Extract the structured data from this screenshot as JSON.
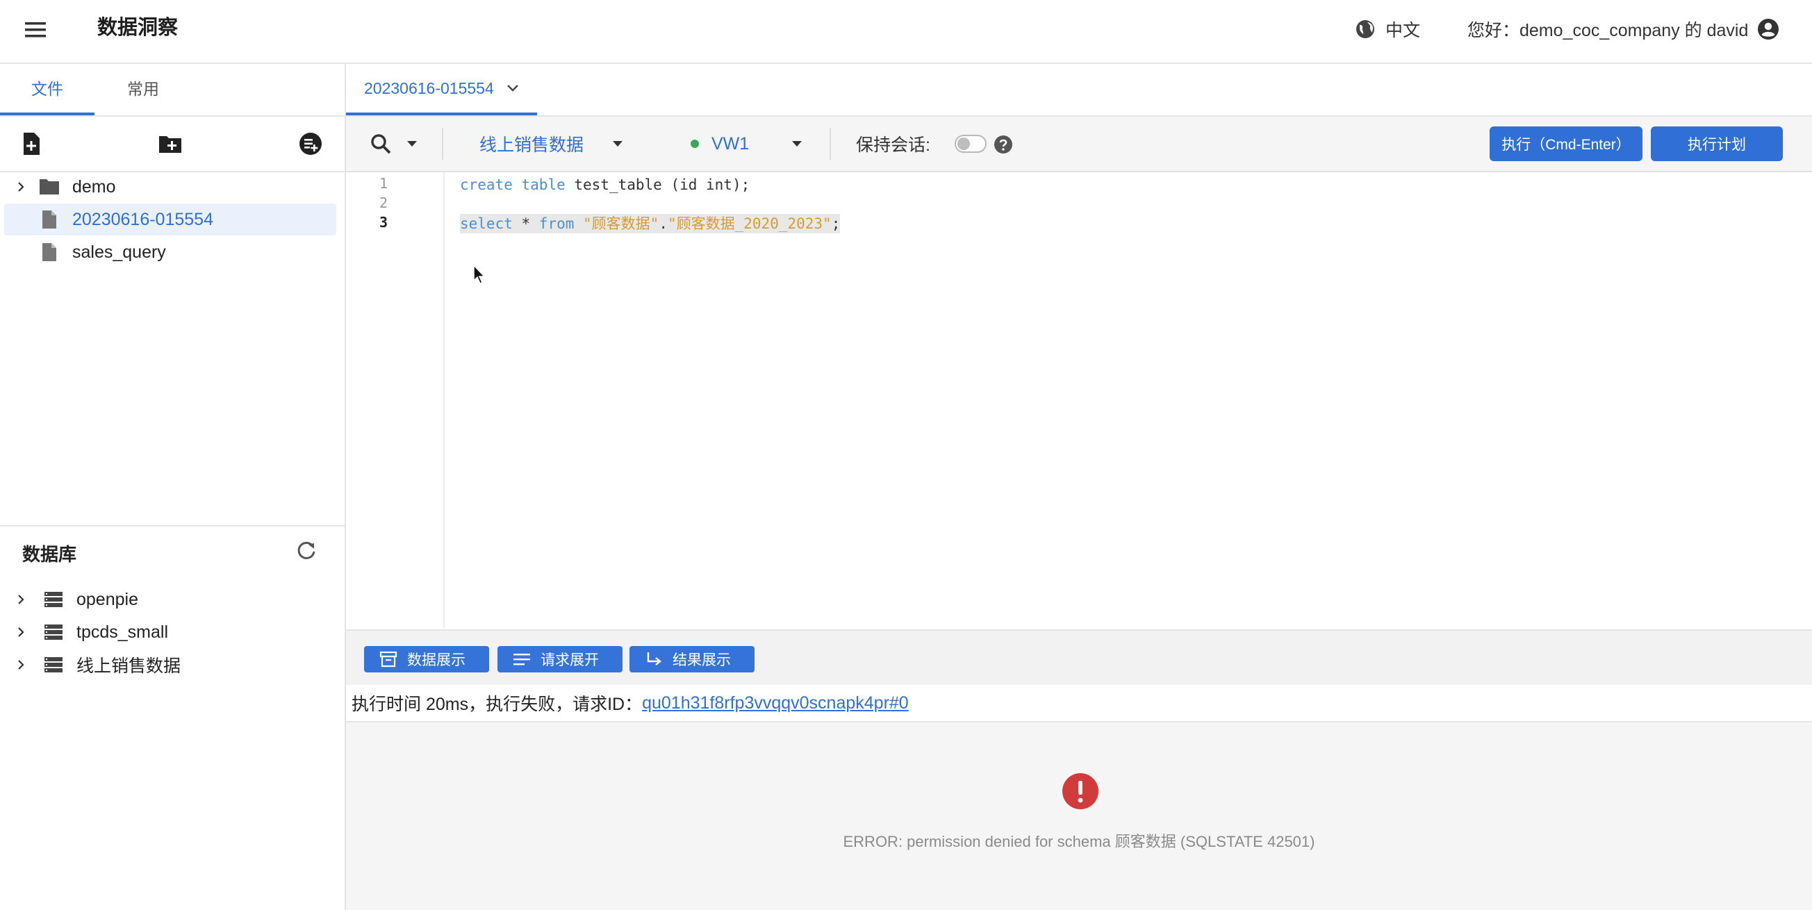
{
  "app": {
    "title": "数据洞察"
  },
  "header": {
    "language": "中文",
    "greeting": "您好：demo_coc_company 的 david"
  },
  "sidebar": {
    "tabs": [
      {
        "label": "文件",
        "active": true
      },
      {
        "label": "常用",
        "active": false
      }
    ],
    "files": [
      {
        "label": "demo",
        "type": "folder"
      },
      {
        "label": "20230616-015554",
        "type": "file",
        "selected": true
      },
      {
        "label": "sales_query",
        "type": "file"
      }
    ],
    "database_title": "数据库",
    "databases": [
      {
        "label": "openpie"
      },
      {
        "label": "tpcds_small"
      },
      {
        "label": "线上销售数据"
      }
    ]
  },
  "editor_tab": {
    "label": "20230616-015554"
  },
  "toolbar": {
    "database": "线上销售数据",
    "warehouse": "VW1",
    "keep_session_label": "保持会话:",
    "execute_label": "执行（Cmd-Enter）",
    "plan_label": "执行计划"
  },
  "editor": {
    "line_numbers": [
      "1",
      "2",
      "3"
    ],
    "line1": {
      "kw1": "create",
      "kw2": "table",
      "rest": " test_table (id int);"
    },
    "line3": {
      "kw1": "select",
      "mid": " * ",
      "kw2": "from",
      "str1": "\"顾客数据\"",
      "dot": ".",
      "str2": "\"顾客数据_2020_2023\"",
      "end": ";"
    }
  },
  "results": {
    "buttons": {
      "data": "数据展示",
      "request": "请求展开",
      "result": "结果展示"
    },
    "status_prefix": "执行时间 20ms，执行失败，请求ID：",
    "request_id": "qu01h31f8rfp3vvqqv0scnapk4pr#0",
    "error_message": "ERROR: permission denied for schema 顾客数据 (SQLSTATE 42501)"
  },
  "colors": {
    "accent": "#2f6fd6",
    "error": "#d23b3b",
    "status_green": "#3aa757"
  }
}
